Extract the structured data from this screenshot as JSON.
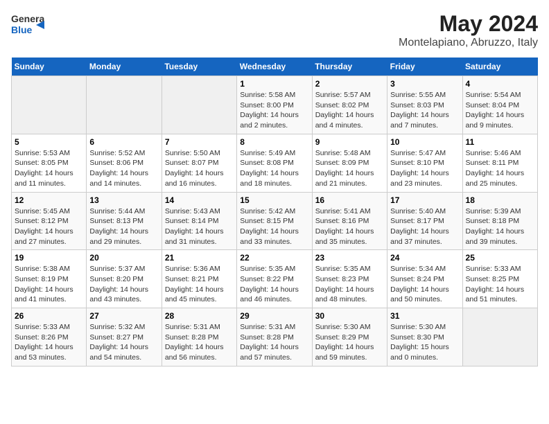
{
  "header": {
    "logo_line1": "General",
    "logo_line2": "Blue",
    "month": "May 2024",
    "location": "Montelapiano, Abruzzo, Italy"
  },
  "days_of_week": [
    "Sunday",
    "Monday",
    "Tuesday",
    "Wednesday",
    "Thursday",
    "Friday",
    "Saturday"
  ],
  "weeks": [
    [
      {
        "day": "",
        "info": ""
      },
      {
        "day": "",
        "info": ""
      },
      {
        "day": "",
        "info": ""
      },
      {
        "day": "1",
        "info": "Sunrise: 5:58 AM\nSunset: 8:00 PM\nDaylight: 14 hours\nand 2 minutes."
      },
      {
        "day": "2",
        "info": "Sunrise: 5:57 AM\nSunset: 8:02 PM\nDaylight: 14 hours\nand 4 minutes."
      },
      {
        "day": "3",
        "info": "Sunrise: 5:55 AM\nSunset: 8:03 PM\nDaylight: 14 hours\nand 7 minutes."
      },
      {
        "day": "4",
        "info": "Sunrise: 5:54 AM\nSunset: 8:04 PM\nDaylight: 14 hours\nand 9 minutes."
      }
    ],
    [
      {
        "day": "5",
        "info": "Sunrise: 5:53 AM\nSunset: 8:05 PM\nDaylight: 14 hours\nand 11 minutes."
      },
      {
        "day": "6",
        "info": "Sunrise: 5:52 AM\nSunset: 8:06 PM\nDaylight: 14 hours\nand 14 minutes."
      },
      {
        "day": "7",
        "info": "Sunrise: 5:50 AM\nSunset: 8:07 PM\nDaylight: 14 hours\nand 16 minutes."
      },
      {
        "day": "8",
        "info": "Sunrise: 5:49 AM\nSunset: 8:08 PM\nDaylight: 14 hours\nand 18 minutes."
      },
      {
        "day": "9",
        "info": "Sunrise: 5:48 AM\nSunset: 8:09 PM\nDaylight: 14 hours\nand 21 minutes."
      },
      {
        "day": "10",
        "info": "Sunrise: 5:47 AM\nSunset: 8:10 PM\nDaylight: 14 hours\nand 23 minutes."
      },
      {
        "day": "11",
        "info": "Sunrise: 5:46 AM\nSunset: 8:11 PM\nDaylight: 14 hours\nand 25 minutes."
      }
    ],
    [
      {
        "day": "12",
        "info": "Sunrise: 5:45 AM\nSunset: 8:12 PM\nDaylight: 14 hours\nand 27 minutes."
      },
      {
        "day": "13",
        "info": "Sunrise: 5:44 AM\nSunset: 8:13 PM\nDaylight: 14 hours\nand 29 minutes."
      },
      {
        "day": "14",
        "info": "Sunrise: 5:43 AM\nSunset: 8:14 PM\nDaylight: 14 hours\nand 31 minutes."
      },
      {
        "day": "15",
        "info": "Sunrise: 5:42 AM\nSunset: 8:15 PM\nDaylight: 14 hours\nand 33 minutes."
      },
      {
        "day": "16",
        "info": "Sunrise: 5:41 AM\nSunset: 8:16 PM\nDaylight: 14 hours\nand 35 minutes."
      },
      {
        "day": "17",
        "info": "Sunrise: 5:40 AM\nSunset: 8:17 PM\nDaylight: 14 hours\nand 37 minutes."
      },
      {
        "day": "18",
        "info": "Sunrise: 5:39 AM\nSunset: 8:18 PM\nDaylight: 14 hours\nand 39 minutes."
      }
    ],
    [
      {
        "day": "19",
        "info": "Sunrise: 5:38 AM\nSunset: 8:19 PM\nDaylight: 14 hours\nand 41 minutes."
      },
      {
        "day": "20",
        "info": "Sunrise: 5:37 AM\nSunset: 8:20 PM\nDaylight: 14 hours\nand 43 minutes."
      },
      {
        "day": "21",
        "info": "Sunrise: 5:36 AM\nSunset: 8:21 PM\nDaylight: 14 hours\nand 45 minutes."
      },
      {
        "day": "22",
        "info": "Sunrise: 5:35 AM\nSunset: 8:22 PM\nDaylight: 14 hours\nand 46 minutes."
      },
      {
        "day": "23",
        "info": "Sunrise: 5:35 AM\nSunset: 8:23 PM\nDaylight: 14 hours\nand 48 minutes."
      },
      {
        "day": "24",
        "info": "Sunrise: 5:34 AM\nSunset: 8:24 PM\nDaylight: 14 hours\nand 50 minutes."
      },
      {
        "day": "25",
        "info": "Sunrise: 5:33 AM\nSunset: 8:25 PM\nDaylight: 14 hours\nand 51 minutes."
      }
    ],
    [
      {
        "day": "26",
        "info": "Sunrise: 5:33 AM\nSunset: 8:26 PM\nDaylight: 14 hours\nand 53 minutes."
      },
      {
        "day": "27",
        "info": "Sunrise: 5:32 AM\nSunset: 8:27 PM\nDaylight: 14 hours\nand 54 minutes."
      },
      {
        "day": "28",
        "info": "Sunrise: 5:31 AM\nSunset: 8:28 PM\nDaylight: 14 hours\nand 56 minutes."
      },
      {
        "day": "29",
        "info": "Sunrise: 5:31 AM\nSunset: 8:28 PM\nDaylight: 14 hours\nand 57 minutes."
      },
      {
        "day": "30",
        "info": "Sunrise: 5:30 AM\nSunset: 8:29 PM\nDaylight: 14 hours\nand 59 minutes."
      },
      {
        "day": "31",
        "info": "Sunrise: 5:30 AM\nSunset: 8:30 PM\nDaylight: 15 hours\nand 0 minutes."
      },
      {
        "day": "",
        "info": ""
      }
    ]
  ]
}
